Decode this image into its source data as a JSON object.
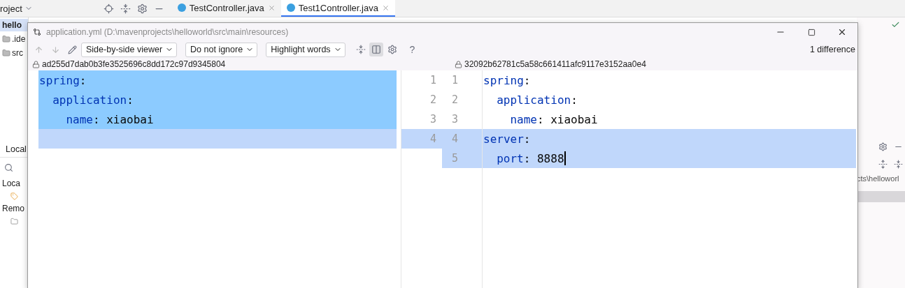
{
  "ide": {
    "project_label": "roject",
    "tabs": [
      {
        "label": "TestController.java",
        "selected": false
      },
      {
        "label": "Test1Controller.java",
        "selected": true
      }
    ],
    "tree": [
      {
        "label": "hello",
        "selected": true
      },
      {
        "label": ".ide",
        "selected": false
      },
      {
        "label": "src",
        "selected": false
      }
    ],
    "bottom_tab": "Local",
    "bottom_tree": [
      {
        "label": "Loca"
      },
      {
        "label": "Remo"
      }
    ],
    "right_path": "cts\\helloworl"
  },
  "dialog": {
    "title": "application.yml (D:\\mavenprojects\\helloworld\\src\\main\\resources)",
    "toolbar": {
      "dropdowns": [
        {
          "label": "Side-by-side viewer"
        },
        {
          "label": "Do not ignore"
        },
        {
          "label": "Highlight words"
        }
      ],
      "sync_scroll_on": true,
      "help": "?",
      "differences": "1 difference"
    },
    "left_revision": "ad255d7dab0b3fe3525696c8dd172c97d9345804",
    "right_revision": "32092b62781c5a58c661411afc9117e3152aa0e4",
    "left_lines": [
      {
        "number": "1",
        "key": "spring",
        "rest": ":",
        "kind": "modified",
        "children": [
          {
            "number": "2",
            "key": "application",
            "rest": ":",
            "kind": "modified",
            "children": [
              {
                "number": "3",
                "key": "name",
                "rest": ": xiaobai",
                "kind": "modified"
              }
            ]
          }
        ]
      },
      {
        "number": "4",
        "kind": "added"
      }
    ],
    "right_lines": [
      {
        "number": "1",
        "key": "spring",
        "rest": ":",
        "kind": "plain",
        "cursor": false,
        "children": [
          {
            "number": "2",
            "key": "application",
            "rest": ":",
            "kind": "plain",
            "cursor": false,
            "children": [
              {
                "number": "3",
                "key": "name",
                "rest": ": xiaobai",
                "kind": "plain",
                "cursor": false
              }
            ]
          }
        ]
      },
      {
        "number": "4",
        "key": "server",
        "rest": ":",
        "kind": "added",
        "cursor": false,
        "children": [
          {
            "number": "5",
            "key": "port",
            "rest": ": 8888",
            "kind": "added",
            "cursor": true
          }
        ]
      }
    ]
  }
}
